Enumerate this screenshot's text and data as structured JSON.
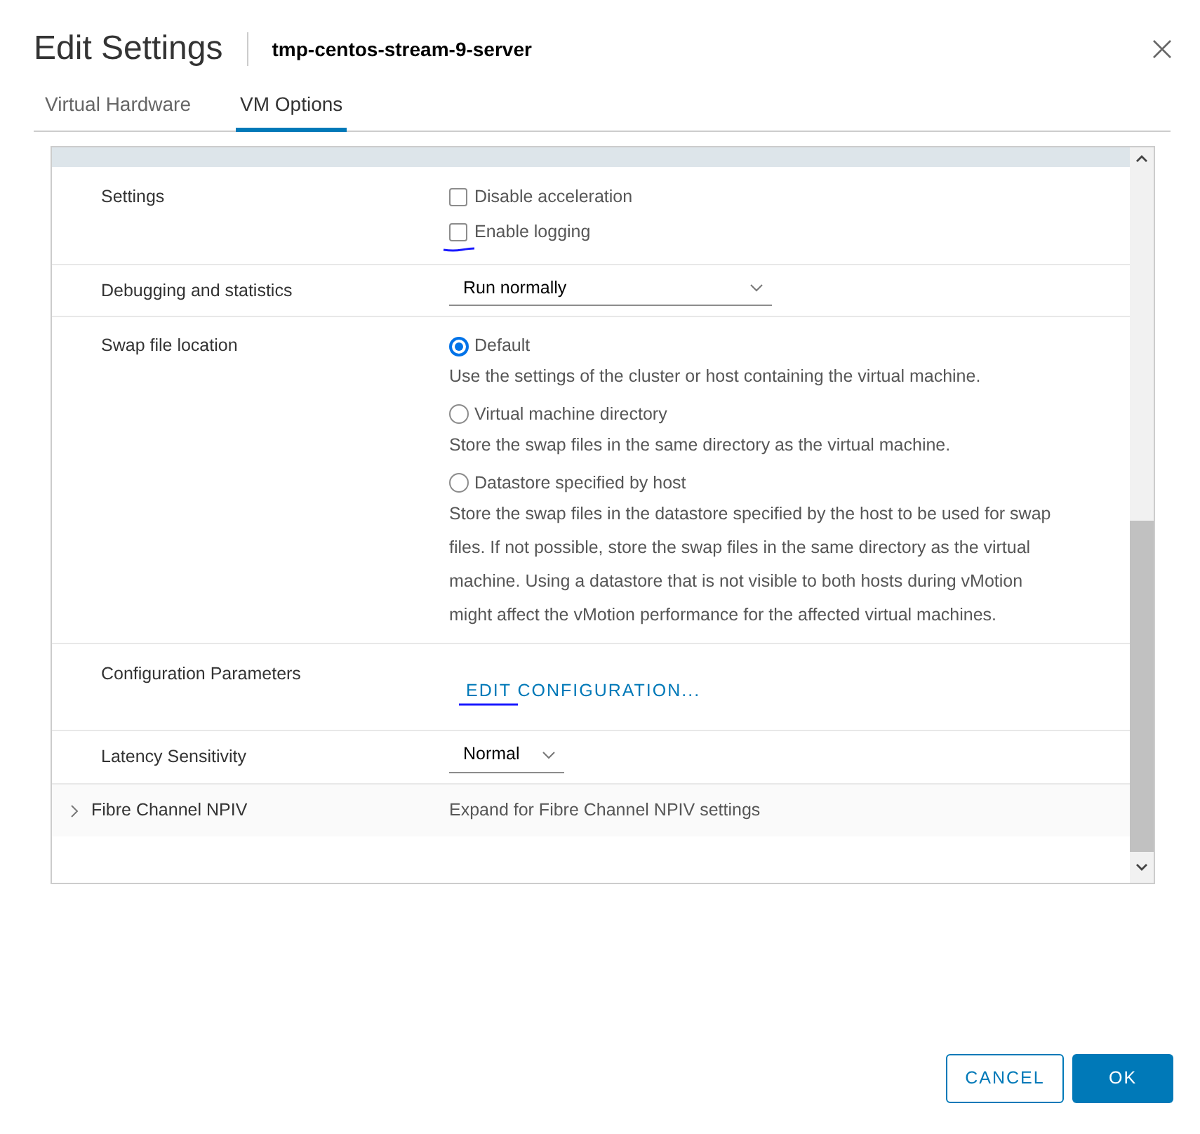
{
  "dialog": {
    "title": "Edit Settings",
    "subtitle": "tmp-centos-stream-9-server"
  },
  "tabs": [
    {
      "label": "Virtual Hardware",
      "selected": false
    },
    {
      "label": "VM Options",
      "selected": true
    }
  ],
  "rows": [
    {
      "kind": "checkboxes",
      "label": "Settings",
      "options": [
        {
          "label": "Disable acceleration",
          "checked": false,
          "annotated": false
        },
        {
          "label": "Enable logging",
          "checked": false,
          "annotated": true
        }
      ]
    },
    {
      "kind": "select",
      "label": "Debugging and statistics",
      "value": "Run normally"
    },
    {
      "kind": "radios",
      "label": "Swap file location",
      "options": [
        {
          "label": "Default",
          "selected": true,
          "description": "Use the settings of the cluster or host containing the virtual machine."
        },
        {
          "label": "Virtual machine directory",
          "selected": false,
          "description": "Store the swap files in the same directory as the virtual machine."
        },
        {
          "label": "Datastore specified by host",
          "selected": false,
          "description": "Store the swap files in the datastore specified by the host to be used for swap files. If not possible, store the swap files in the same directory as the virtual machine. Using a datastore that is not visible to both hosts during vMotion might affect the vMotion performance for the affected virtual machines."
        }
      ]
    },
    {
      "kind": "link",
      "label": "Configuration Parameters",
      "link": "EDIT CONFIGURATION...",
      "annotated": true
    },
    {
      "kind": "select",
      "label": "Latency Sensitivity",
      "value": "Normal"
    },
    {
      "kind": "section",
      "label": "Fibre Channel NPIV",
      "description": "Expand for Fibre Channel NPIV settings",
      "expanded": false
    }
  ],
  "buttons": [
    {
      "label": "CANCEL",
      "kind": "secondary"
    },
    {
      "label": "OK",
      "kind": "primary"
    }
  ]
}
